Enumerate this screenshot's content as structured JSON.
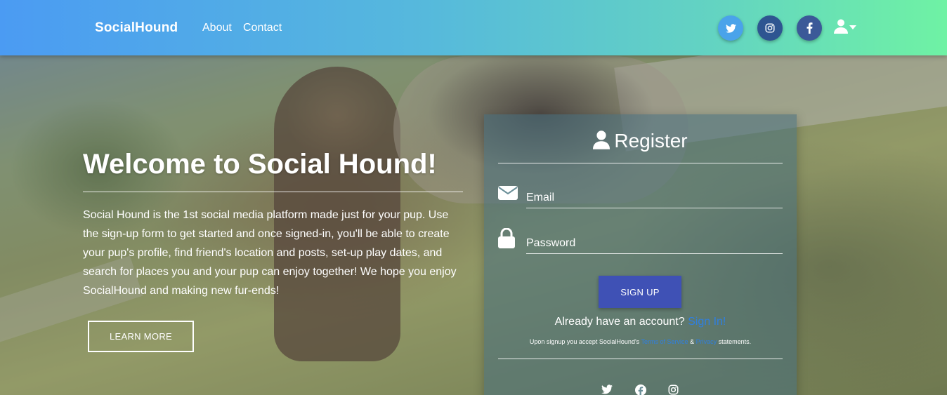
{
  "navbar": {
    "brand": "SocialHound",
    "links": [
      "About",
      "Contact"
    ]
  },
  "hero": {
    "title": "Welcome to Social Hound!",
    "intro": "Social Hound is the 1st social media platform made just for your pup. Use the sign-up form to get started and once signed-in, you'll be able to create your pup's profile, find friend's location and posts, set-up play dates, and search for places you and your pup can enjoy together! We hope you enjoy SocialHound and making new fur-ends!",
    "learn_more": "LEARN MORE"
  },
  "register": {
    "title": "Register",
    "email_placeholder": "Email",
    "password_placeholder": "Password",
    "signup_label": "SIGN UP",
    "already_text": "Already have an account?",
    "signin_link": "Sign In!",
    "terms_prefix": "Upon signup you accept SocialHound's",
    "terms_link": "Terms of Service",
    "terms_and": "&",
    "privacy_link": "Privacy",
    "terms_suffix": "statements."
  },
  "icons": {
    "twitter": "twitter-icon",
    "instagram": "instagram-icon",
    "facebook": "facebook-icon",
    "user": "user-icon",
    "envelope": "envelope-icon",
    "lock": "lock-icon"
  },
  "colors": {
    "navbar_start": "#4b9bf3",
    "navbar_end": "#6ff2a4",
    "twitter_button": "#4aa3ea",
    "instagram_button": "#2e5591",
    "facebook_button": "#3b5998",
    "signup_button": "#3f51b5",
    "link": "#2f7fe0"
  }
}
